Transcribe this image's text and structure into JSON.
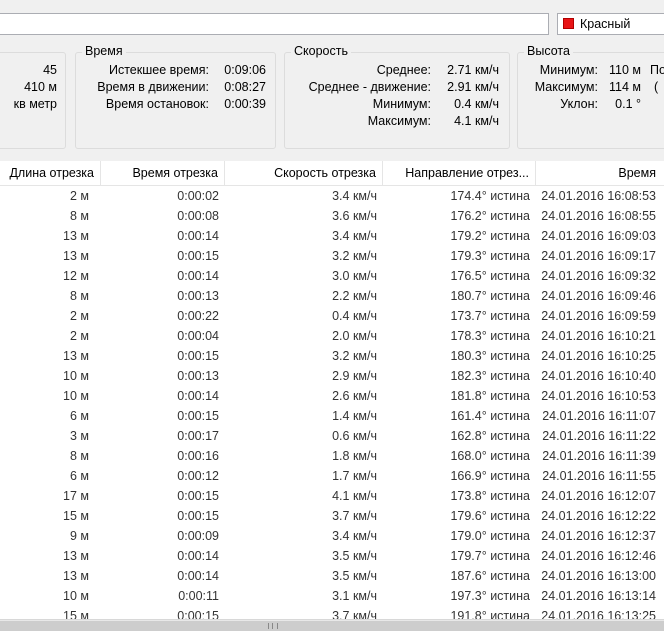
{
  "top": {
    "name_value": "",
    "color_label": "Красный",
    "color_hex": "#e81416"
  },
  "info": {
    "partial_values": [
      "45",
      "410 м",
      "кв метр"
    ],
    "time": {
      "title": "Время",
      "rows": [
        {
          "label": "Истекшее время:",
          "value": "0:09:06"
        },
        {
          "label": "Время в движении:",
          "value": "0:08:27"
        },
        {
          "label": "Время остановок:",
          "value": "0:00:39"
        }
      ]
    },
    "speed": {
      "title": "Скорость",
      "rows": [
        {
          "label": "Среднее:",
          "value": "2.71 км/ч"
        },
        {
          "label": "Среднее - движение:",
          "value": "2.91 км/ч"
        },
        {
          "label": "Минимум:",
          "value": "0.4 км/ч"
        },
        {
          "label": "Максимум:",
          "value": "4.1 км/ч"
        }
      ]
    },
    "height": {
      "title": "Высота",
      "rows": [
        {
          "label": "Минимум:",
          "value": "110 м",
          "extra": "По"
        },
        {
          "label": "Максимум:",
          "value": "114 м",
          "extra": "("
        },
        {
          "label": "Уклон:",
          "value": "0.1 °",
          "extra": ""
        }
      ]
    }
  },
  "table": {
    "columns": [
      "Длина отрезка",
      "Время отрезка",
      "Скорость отрезка",
      "Направление отрез...",
      "Время"
    ],
    "rows": [
      [
        "2 м",
        "0:00:02",
        "3.4 км/ч",
        "174.4° истина",
        "24.01.2016 16:08:53"
      ],
      [
        "8 м",
        "0:00:08",
        "3.6 км/ч",
        "176.2° истина",
        "24.01.2016 16:08:55"
      ],
      [
        "13 м",
        "0:00:14",
        "3.4 км/ч",
        "179.2° истина",
        "24.01.2016 16:09:03"
      ],
      [
        "13 м",
        "0:00:15",
        "3.2 км/ч",
        "179.3° истина",
        "24.01.2016 16:09:17"
      ],
      [
        "12 м",
        "0:00:14",
        "3.0 км/ч",
        "176.5° истина",
        "24.01.2016 16:09:32"
      ],
      [
        "8 м",
        "0:00:13",
        "2.2 км/ч",
        "180.7° истина",
        "24.01.2016 16:09:46"
      ],
      [
        "2 м",
        "0:00:22",
        "0.4 км/ч",
        "173.7° истина",
        "24.01.2016 16:09:59"
      ],
      [
        "2 м",
        "0:00:04",
        "2.0 км/ч",
        "178.3° истина",
        "24.01.2016 16:10:21"
      ],
      [
        "13 м",
        "0:00:15",
        "3.2 км/ч",
        "180.3° истина",
        "24.01.2016 16:10:25"
      ],
      [
        "10 м",
        "0:00:13",
        "2.9 км/ч",
        "182.3° истина",
        "24.01.2016 16:10:40"
      ],
      [
        "10 м",
        "0:00:14",
        "2.6 км/ч",
        "181.8° истина",
        "24.01.2016 16:10:53"
      ],
      [
        "6 м",
        "0:00:15",
        "1.4 км/ч",
        "161.4° истина",
        "24.01.2016 16:11:07"
      ],
      [
        "3 м",
        "0:00:17",
        "0.6 км/ч",
        "162.8° истина",
        "24.01.2016 16:11:22"
      ],
      [
        "8 м",
        "0:00:16",
        "1.8 км/ч",
        "168.0° истина",
        "24.01.2016 16:11:39"
      ],
      [
        "6 м",
        "0:00:12",
        "1.7 км/ч",
        "166.9° истина",
        "24.01.2016 16:11:55"
      ],
      [
        "17 м",
        "0:00:15",
        "4.1 км/ч",
        "173.8° истина",
        "24.01.2016 16:12:07"
      ],
      [
        "15 м",
        "0:00:15",
        "3.7 км/ч",
        "179.6° истина",
        "24.01.2016 16:12:22"
      ],
      [
        "9 м",
        "0:00:09",
        "3.4 км/ч",
        "179.0° истина",
        "24.01.2016 16:12:37"
      ],
      [
        "13 м",
        "0:00:14",
        "3.5 км/ч",
        "179.7° истина",
        "24.01.2016 16:12:46"
      ],
      [
        "13 м",
        "0:00:14",
        "3.5 км/ч",
        "187.6° истина",
        "24.01.2016 16:13:00"
      ],
      [
        "10 м",
        "0:00:11",
        "3.1 км/ч",
        "197.3° истина",
        "24.01.2016 16:13:14"
      ],
      [
        "15 м",
        "0:00:15",
        "3.7 км/ч",
        "191.8° истина",
        "24.01.2016 16:13:25"
      ]
    ]
  }
}
